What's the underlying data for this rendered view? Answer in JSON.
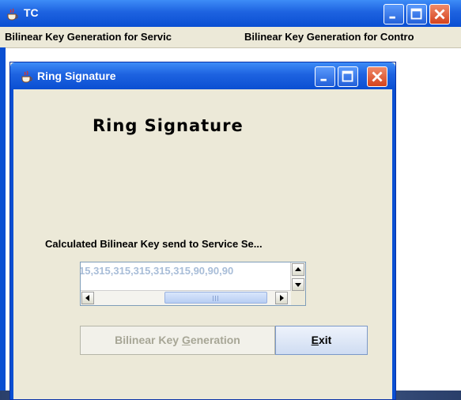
{
  "outer_window": {
    "title": "TC",
    "menu": [
      "Bilinear Key Generation for Servic",
      "Bilinear Key Generation for Contro"
    ]
  },
  "dialog": {
    "title": "Ring Signature",
    "heading": "Ring Signature",
    "status": "Calculated Bilinear Key send to Service Se...",
    "key_text": "15,315,315,315,315,315,90,90,90",
    "buttons": {
      "generate": {
        "pre": "Bilinear Key ",
        "mnemonic": "G",
        "post": "eneration"
      },
      "exit": {
        "pre": "",
        "mnemonic": "E",
        "post": "xit"
      }
    }
  },
  "colors": {
    "titlebar": "#1d62e0",
    "close_button": "#d4431d",
    "panel": "#ece9d8"
  },
  "icons": [
    "java-cup-icon",
    "minimize-icon",
    "maximize-icon",
    "close-icon",
    "scroll-up-icon",
    "scroll-down-icon",
    "scroll-left-icon",
    "scroll-right-icon"
  ]
}
